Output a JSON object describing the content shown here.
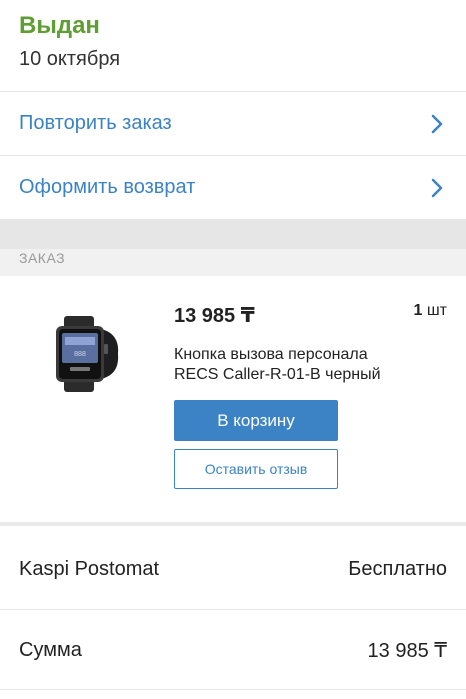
{
  "order": {
    "status": "Выдан",
    "date": "10 октября"
  },
  "actions": {
    "repeat_label": "Повторить заказ",
    "return_label": "Оформить возврат"
  },
  "section": {
    "title": "ЗАКАЗ"
  },
  "item": {
    "price": "13 985 ₸",
    "qty_number": "1",
    "qty_unit": "шт",
    "name": "Кнопка вызова персонала RECS Caller-R-01-B черный",
    "cart_button": "В корзину",
    "review_button": "Оставить отзыв"
  },
  "summary": {
    "delivery_label": "Kaspi Postomat",
    "delivery_value": "Бесплатно",
    "total_label": "Сумма",
    "total_value": "13 985 ₸"
  },
  "colors": {
    "status_green": "#5f9e32",
    "accent_blue": "#3b83c5"
  },
  "icons": {
    "row_chevron": "chevron-right-icon"
  }
}
